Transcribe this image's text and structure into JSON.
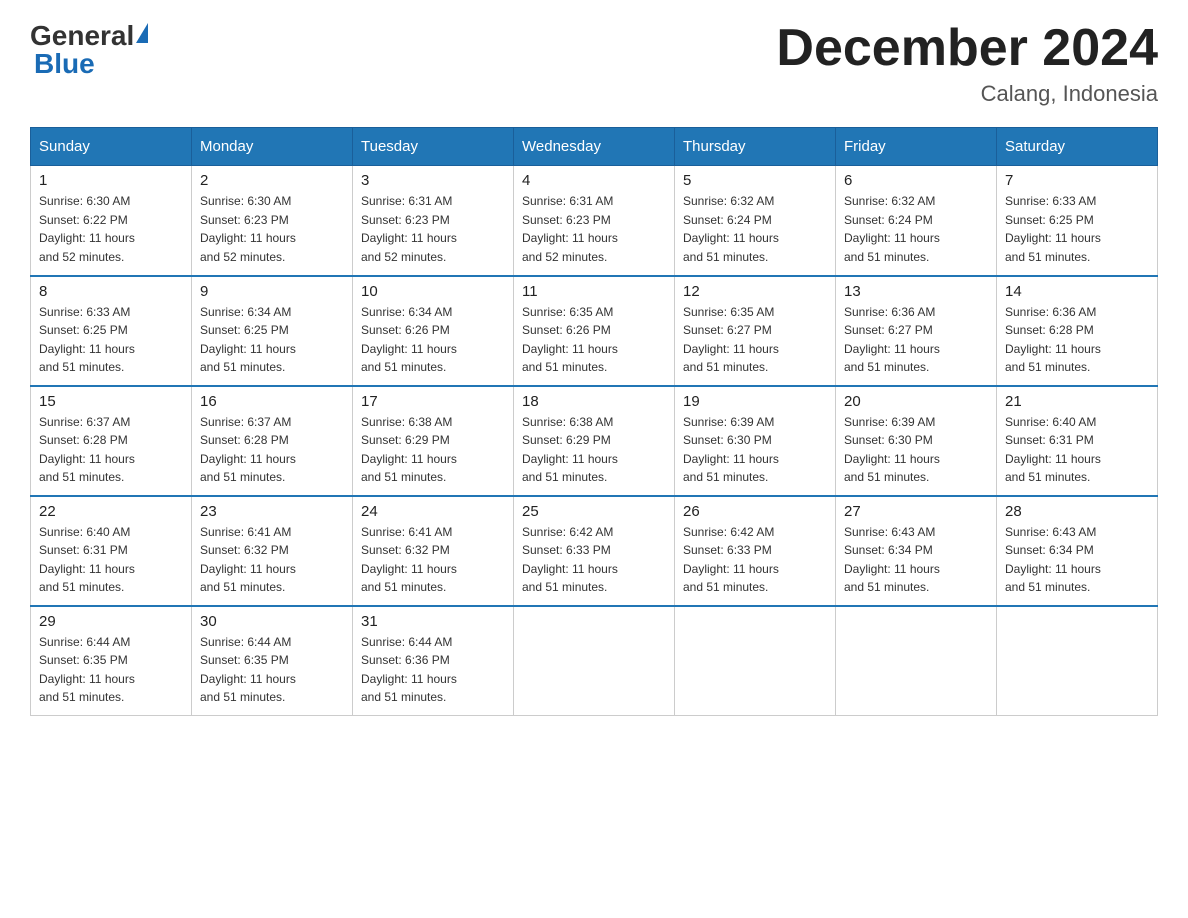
{
  "header": {
    "logo_general": "General",
    "logo_blue": "Blue",
    "title": "December 2024",
    "subtitle": "Calang, Indonesia"
  },
  "days_of_week": [
    "Sunday",
    "Monday",
    "Tuesday",
    "Wednesday",
    "Thursday",
    "Friday",
    "Saturday"
  ],
  "weeks": [
    [
      {
        "day": "1",
        "sunrise": "6:30 AM",
        "sunset": "6:22 PM",
        "daylight": "11 hours and 52 minutes."
      },
      {
        "day": "2",
        "sunrise": "6:30 AM",
        "sunset": "6:23 PM",
        "daylight": "11 hours and 52 minutes."
      },
      {
        "day": "3",
        "sunrise": "6:31 AM",
        "sunset": "6:23 PM",
        "daylight": "11 hours and 52 minutes."
      },
      {
        "day": "4",
        "sunrise": "6:31 AM",
        "sunset": "6:23 PM",
        "daylight": "11 hours and 52 minutes."
      },
      {
        "day": "5",
        "sunrise": "6:32 AM",
        "sunset": "6:24 PM",
        "daylight": "11 hours and 51 minutes."
      },
      {
        "day": "6",
        "sunrise": "6:32 AM",
        "sunset": "6:24 PM",
        "daylight": "11 hours and 51 minutes."
      },
      {
        "day": "7",
        "sunrise": "6:33 AM",
        "sunset": "6:25 PM",
        "daylight": "11 hours and 51 minutes."
      }
    ],
    [
      {
        "day": "8",
        "sunrise": "6:33 AM",
        "sunset": "6:25 PM",
        "daylight": "11 hours and 51 minutes."
      },
      {
        "day": "9",
        "sunrise": "6:34 AM",
        "sunset": "6:25 PM",
        "daylight": "11 hours and 51 minutes."
      },
      {
        "day": "10",
        "sunrise": "6:34 AM",
        "sunset": "6:26 PM",
        "daylight": "11 hours and 51 minutes."
      },
      {
        "day": "11",
        "sunrise": "6:35 AM",
        "sunset": "6:26 PM",
        "daylight": "11 hours and 51 minutes."
      },
      {
        "day": "12",
        "sunrise": "6:35 AM",
        "sunset": "6:27 PM",
        "daylight": "11 hours and 51 minutes."
      },
      {
        "day": "13",
        "sunrise": "6:36 AM",
        "sunset": "6:27 PM",
        "daylight": "11 hours and 51 minutes."
      },
      {
        "day": "14",
        "sunrise": "6:36 AM",
        "sunset": "6:28 PM",
        "daylight": "11 hours and 51 minutes."
      }
    ],
    [
      {
        "day": "15",
        "sunrise": "6:37 AM",
        "sunset": "6:28 PM",
        "daylight": "11 hours and 51 minutes."
      },
      {
        "day": "16",
        "sunrise": "6:37 AM",
        "sunset": "6:28 PM",
        "daylight": "11 hours and 51 minutes."
      },
      {
        "day": "17",
        "sunrise": "6:38 AM",
        "sunset": "6:29 PM",
        "daylight": "11 hours and 51 minutes."
      },
      {
        "day": "18",
        "sunrise": "6:38 AM",
        "sunset": "6:29 PM",
        "daylight": "11 hours and 51 minutes."
      },
      {
        "day": "19",
        "sunrise": "6:39 AM",
        "sunset": "6:30 PM",
        "daylight": "11 hours and 51 minutes."
      },
      {
        "day": "20",
        "sunrise": "6:39 AM",
        "sunset": "6:30 PM",
        "daylight": "11 hours and 51 minutes."
      },
      {
        "day": "21",
        "sunrise": "6:40 AM",
        "sunset": "6:31 PM",
        "daylight": "11 hours and 51 minutes."
      }
    ],
    [
      {
        "day": "22",
        "sunrise": "6:40 AM",
        "sunset": "6:31 PM",
        "daylight": "11 hours and 51 minutes."
      },
      {
        "day": "23",
        "sunrise": "6:41 AM",
        "sunset": "6:32 PM",
        "daylight": "11 hours and 51 minutes."
      },
      {
        "day": "24",
        "sunrise": "6:41 AM",
        "sunset": "6:32 PM",
        "daylight": "11 hours and 51 minutes."
      },
      {
        "day": "25",
        "sunrise": "6:42 AM",
        "sunset": "6:33 PM",
        "daylight": "11 hours and 51 minutes."
      },
      {
        "day": "26",
        "sunrise": "6:42 AM",
        "sunset": "6:33 PM",
        "daylight": "11 hours and 51 minutes."
      },
      {
        "day": "27",
        "sunrise": "6:43 AM",
        "sunset": "6:34 PM",
        "daylight": "11 hours and 51 minutes."
      },
      {
        "day": "28",
        "sunrise": "6:43 AM",
        "sunset": "6:34 PM",
        "daylight": "11 hours and 51 minutes."
      }
    ],
    [
      {
        "day": "29",
        "sunrise": "6:44 AM",
        "sunset": "6:35 PM",
        "daylight": "11 hours and 51 minutes."
      },
      {
        "day": "30",
        "sunrise": "6:44 AM",
        "sunset": "6:35 PM",
        "daylight": "11 hours and 51 minutes."
      },
      {
        "day": "31",
        "sunrise": "6:44 AM",
        "sunset": "6:36 PM",
        "daylight": "11 hours and 51 minutes."
      },
      null,
      null,
      null,
      null
    ]
  ],
  "labels": {
    "sunrise": "Sunrise:",
    "sunset": "Sunset:",
    "daylight": "Daylight:"
  }
}
